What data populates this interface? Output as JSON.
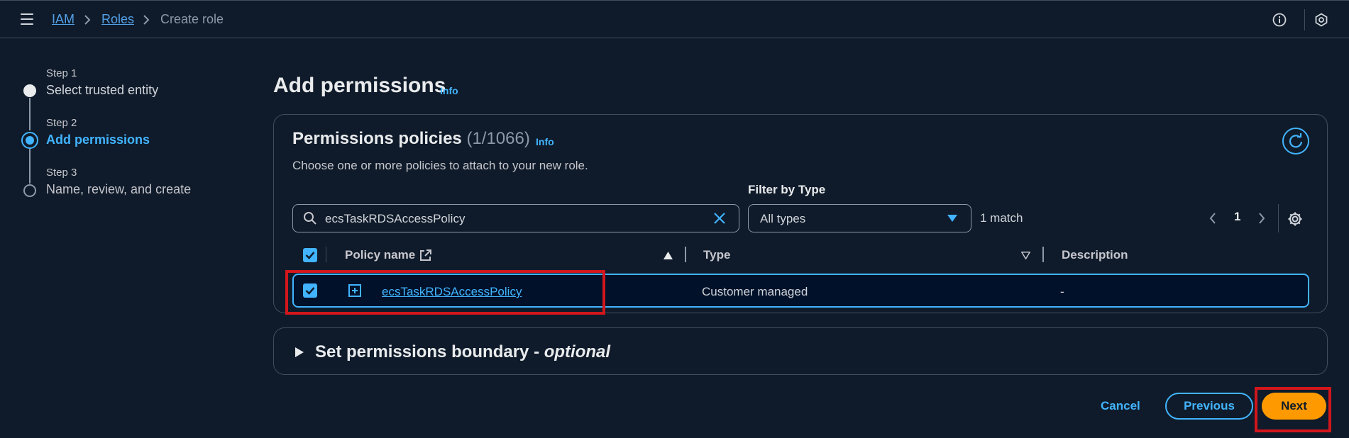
{
  "breadcrumb": {
    "items": [
      "IAM",
      "Roles"
    ],
    "current": "Create role"
  },
  "steps": [
    {
      "number": "Step 1",
      "title": "Select trusted entity",
      "state": "completed"
    },
    {
      "number": "Step 2",
      "title": "Add permissions",
      "state": "active"
    },
    {
      "number": "Step 3",
      "title": "Name, review, and create",
      "state": "pending"
    }
  ],
  "page": {
    "title": "Add permissions",
    "info": "Info"
  },
  "policies_panel": {
    "title": "Permissions policies",
    "count": "(1/1066)",
    "info": "Info",
    "description": "Choose one or more policies to attach to your new role.",
    "filter_label": "Filter by Type",
    "search_value": "ecsTaskRDSAccessPolicy",
    "type_select_value": "All types",
    "match_text": "1 match",
    "current_page": "1",
    "columns": [
      "Policy name",
      "Type",
      "Description"
    ],
    "rows": [
      {
        "name": "ecsTaskRDSAccessPolicy",
        "type": "Customer managed",
        "description": "-",
        "selected": true
      }
    ]
  },
  "boundary": {
    "title": "Set permissions boundary - ",
    "title_optional": "optional"
  },
  "footer": {
    "cancel": "Cancel",
    "previous": "Previous",
    "next": "Next"
  },
  "colors": {
    "background": "#0f1b2a",
    "accent": "#42b4ff",
    "primary_button": "#ff9900",
    "highlight_box": "#d2161c"
  },
  "icons": [
    "menu-icon",
    "chevron-right-icon",
    "info-circle-icon",
    "settings-hexagon-icon",
    "refresh-icon",
    "search-icon",
    "clear-icon",
    "caret-down-icon",
    "chevron-left-icon",
    "gear-icon",
    "external-link-icon",
    "sort-asc-icon",
    "sort-desc-icon",
    "expand-plus-icon",
    "caret-right-icon",
    "checkbox-checked-icon"
  ]
}
